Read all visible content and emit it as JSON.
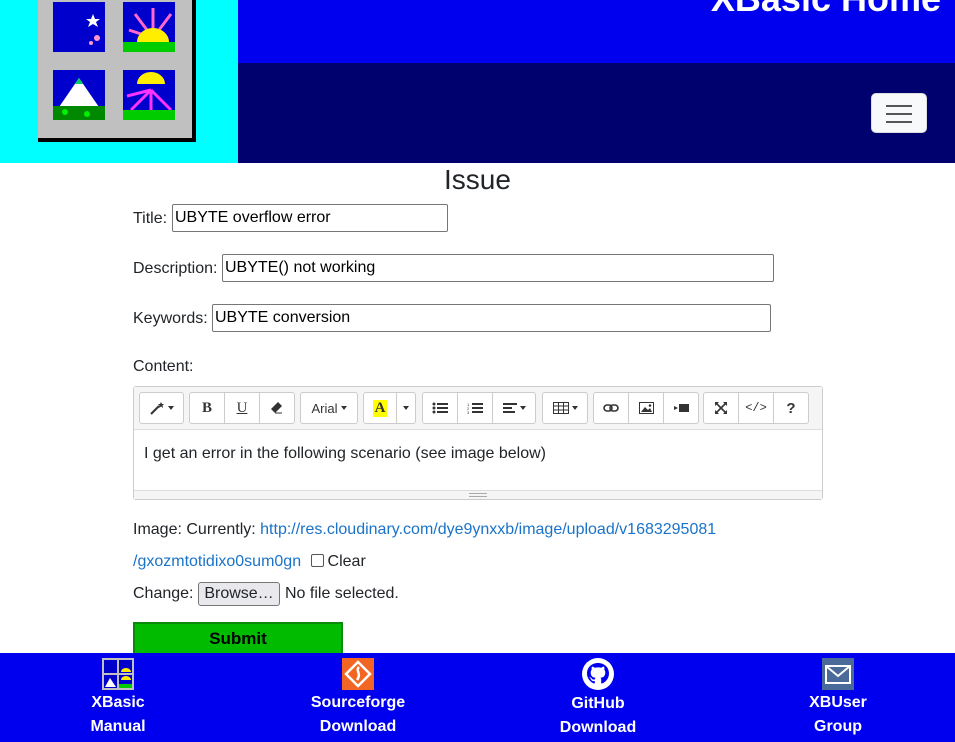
{
  "header": {
    "site_title": "XBasic Home",
    "menu_toggle_label": "Toggle navigation"
  },
  "form": {
    "heading": "Issue",
    "title_label": "Title:",
    "title_value": "UBYTE overflow error",
    "description_label": "Description:",
    "description_value": "UBYTE() not working",
    "keywords_label": "Keywords:",
    "keywords_value": "UBYTE conversion",
    "content_label": "Content:",
    "editor": {
      "font_name": "Arial",
      "content_text": "I get an error in the following scenario (see image below)",
      "bold": "B",
      "underline": "U",
      "help": "?",
      "code": "</>"
    },
    "image_label": "Image: Currently: ",
    "image_url_line1": "http://res.cloudinary.com/dye9ynxxb/image/upload/v1683295081",
    "image_url_line2": "/gxozmtotidixo0sum0gn",
    "clear_label": "Clear",
    "change_label": "Change:",
    "browse_label": "Browse…",
    "no_file_label": "No file selected.",
    "submit_label": "Submit"
  },
  "footer": {
    "items": [
      {
        "line1": "XBasic",
        "line2": "Manual",
        "icon": "xbasic-logo-icon"
      },
      {
        "line1": "Sourceforge",
        "line2": "Download",
        "icon": "sourceforge-icon"
      },
      {
        "line1": "GitHub",
        "line2": "Download",
        "icon": "github-icon"
      },
      {
        "line1": "XBUser",
        "line2": "Group",
        "icon": "mail-group-icon"
      }
    ]
  },
  "colors": {
    "header_cyan": "#00ffff",
    "header_blue": "#0000ee",
    "nav_navy": "#00006e",
    "submit_green": "#00bb00",
    "link_blue": "#1a73c9"
  }
}
